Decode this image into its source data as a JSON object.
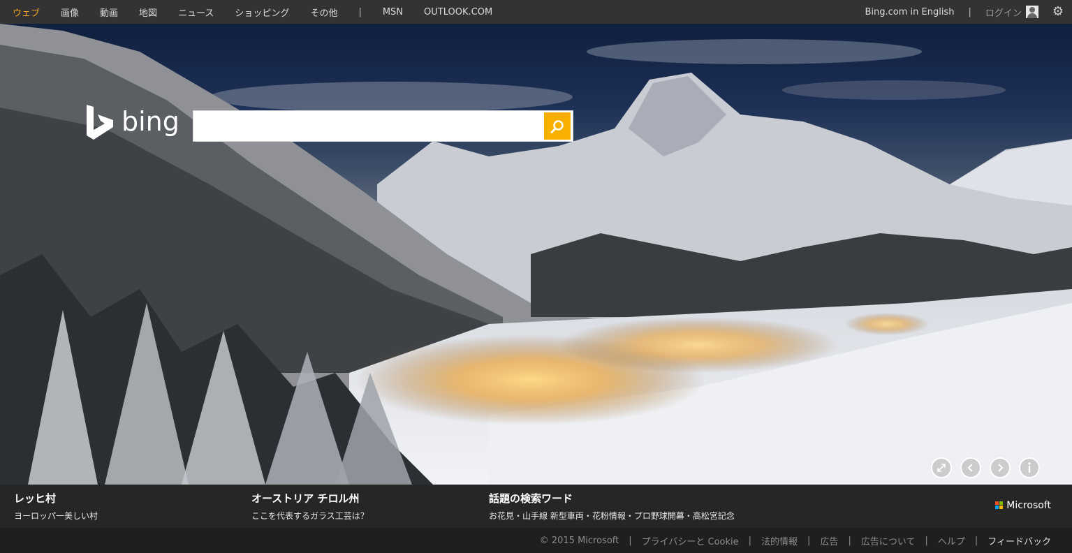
{
  "topbar": {
    "nav": [
      "ウェブ",
      "画像",
      "動画",
      "地図",
      "ニュース",
      "ショッピング",
      "その他"
    ],
    "separator": "|",
    "nav2": [
      "MSN",
      "OUTLOOK.COM"
    ],
    "lang": "Bing.com in English",
    "login": "ログイン"
  },
  "logo": {
    "word": "bing"
  },
  "search": {
    "value": "",
    "placeholder": ""
  },
  "strip": {
    "items": [
      {
        "title": "レッヒ村",
        "sub": "ヨーロッパ一美しい村"
      },
      {
        "title": "オーストリア チロル州",
        "sub": "ここを代表するガラス工芸は？"
      },
      {
        "title": "話題の検索ワード",
        "sub": "お花見・山手線 新型車両・花粉情報・プロ野球開幕・高松宮記念"
      }
    ],
    "brand": "Microsoft"
  },
  "footer": {
    "copyright": "© 2015 Microsoft",
    "links": [
      "プライバシーと Cookie",
      "法的情報",
      "広告",
      "広告について",
      "ヘルプ",
      "フィードバック"
    ],
    "separator": "|"
  },
  "colors": {
    "accent": "#f5a623",
    "search_button": "#f7b000",
    "topbar": "#333333",
    "ms_red": "#f25022",
    "ms_green": "#7fba00",
    "ms_blue": "#00a4ef",
    "ms_yellow": "#ffb900"
  },
  "icons": [
    "bing-logo-icon",
    "search-icon",
    "user-icon",
    "gear-icon",
    "fullscreen-icon",
    "previous-icon",
    "next-icon",
    "info-icon",
    "microsoft-logo-icon"
  ]
}
